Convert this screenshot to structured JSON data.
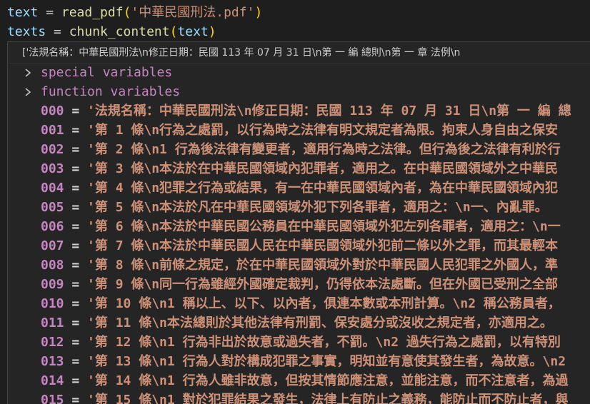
{
  "code": {
    "line1": {
      "var": "text",
      "op": " = ",
      "fn": "read_pdf",
      "open": "(",
      "arg": "'中華民國刑法.pdf'",
      "close": ")"
    },
    "line2": {
      "var": "texts",
      "op": " = ",
      "fn": "chunk_content",
      "open": "(",
      "arg": "text",
      "close": ")"
    }
  },
  "hover": {
    "summary": "['法規名稱：中華民國刑法\\n修正日期：民國 113 年 07 月 31 日\\n第 一 編 總則\\n第 一 章 法例\\n",
    "groups": [
      {
        "label": "special variables",
        "icon": "chevron-right-icon"
      },
      {
        "label": "function variables",
        "icon": "chevron-right-icon"
      }
    ],
    "items": [
      {
        "index": "000",
        "value": "'法規名稱：中華民國刑法\\n修正日期：民國 113 年 07 月 31 日\\n第 一 編 總"
      },
      {
        "index": "001",
        "value": "'第 1 條\\n行為之處罰，以行為時之法律有明文規定者為限。拘束人身自由之保安"
      },
      {
        "index": "002",
        "value": "'第 2 條\\n1 行為後法律有變更者，適用行為時之法律。但行為後之法律有利於行"
      },
      {
        "index": "003",
        "value": "'第 3 條\\n本法於在中華民國領域內犯罪者，適用之。在中華民國領域外之中華民"
      },
      {
        "index": "004",
        "value": "'第 4 條\\n犯罪之行為或結果，有一在中華民國領域內者，為在中華民國領域內犯"
      },
      {
        "index": "005",
        "value": "'第 5 條\\n本法於凡在中華民國領域外犯下列各罪者，適用之：\\n一、內亂罪。"
      },
      {
        "index": "006",
        "value": "'第 6 條\\n本法於中華民國公務員在中華民國領域外犯左列各罪者，適用之：\\n一"
      },
      {
        "index": "007",
        "value": "'第 7 條\\n本法於中華民國人民在中華民國領域外犯前二條以外之罪，而其最輕本"
      },
      {
        "index": "008",
        "value": "'第 8 條\\n前條之規定，於在中華民國領域外對於中華民國人民犯罪之外國人，準"
      },
      {
        "index": "009",
        "value": "'第 9 條\\n同一行為雖經外國確定裁判，仍得依本法處斷。但在外國已受刑之全部"
      },
      {
        "index": "010",
        "value": "'第 10 條\\n1 稱以上、以下、以內者，俱連本數或本刑計算。\\n2 稱公務員者，"
      },
      {
        "index": "011",
        "value": "'第 11 條\\n本法總則於其他法律有刑罰、保安處分或沒收之規定者，亦適用之。"
      },
      {
        "index": "012",
        "value": "'第 12 條\\n1 行為非出於故意或過失者，不罰。\\n2 過失行為之處罰，以有特別"
      },
      {
        "index": "013",
        "value": "'第 13 條\\n1 行為人對於構成犯罪之事實，明知並有意使其發生者，為故意。\\n2"
      },
      {
        "index": "014",
        "value": "'第 14 條\\n1 行為人雖非故意，但按其情節應注意，並能注意，而不注意者，為過"
      },
      {
        "index": "015",
        "value": "'第 15 條\\n1 對於犯罪結果之發生，法律上有防止之義務，能防止而不防止者，與"
      }
    ]
  }
}
